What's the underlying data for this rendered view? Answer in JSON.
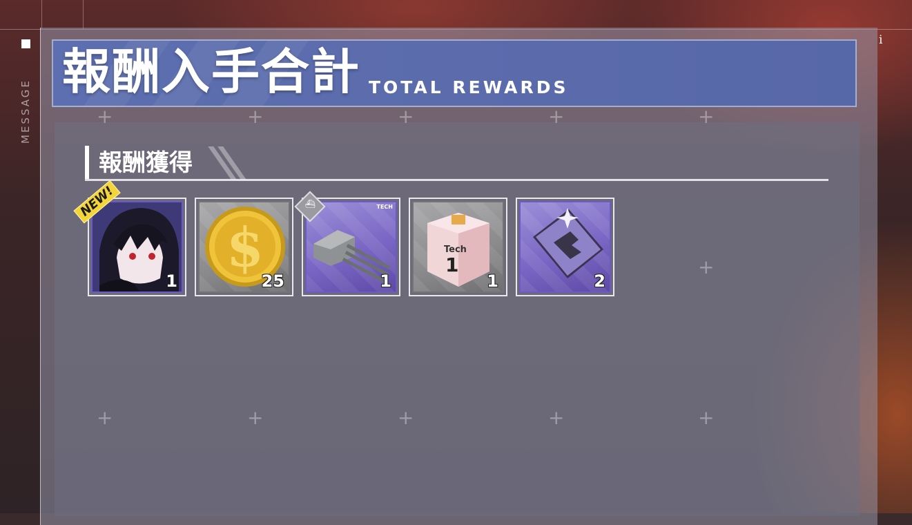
{
  "sidebar": {
    "label": "MESSAGE"
  },
  "header": {
    "title_jp": "報酬入手合計",
    "title_en": "TOTAL REWARDS"
  },
  "section": {
    "title": "報酬獲得"
  },
  "rewards": [
    {
      "icon": "character-portrait-icon",
      "count": "1",
      "badge": "NEW!",
      "rarity": "purple"
    },
    {
      "icon": "gold-coin-icon",
      "count": "25",
      "rarity": "gray"
    },
    {
      "icon": "main-gun-turret-icon",
      "count": "1",
      "corner_label": "TECH",
      "rarity": "purple"
    },
    {
      "icon": "tech-box-icon",
      "count": "1",
      "box_label": "Tech",
      "box_number": "1",
      "rarity": "gray"
    },
    {
      "icon": "blueprint-plate-icon",
      "count": "2",
      "rarity": "purple"
    }
  ],
  "colors": {
    "header_blue": "#5b6bac",
    "rarity_purple": "#7a66c4",
    "rarity_gray": "#8a8a8c",
    "new_badge": "#f3d43a"
  }
}
